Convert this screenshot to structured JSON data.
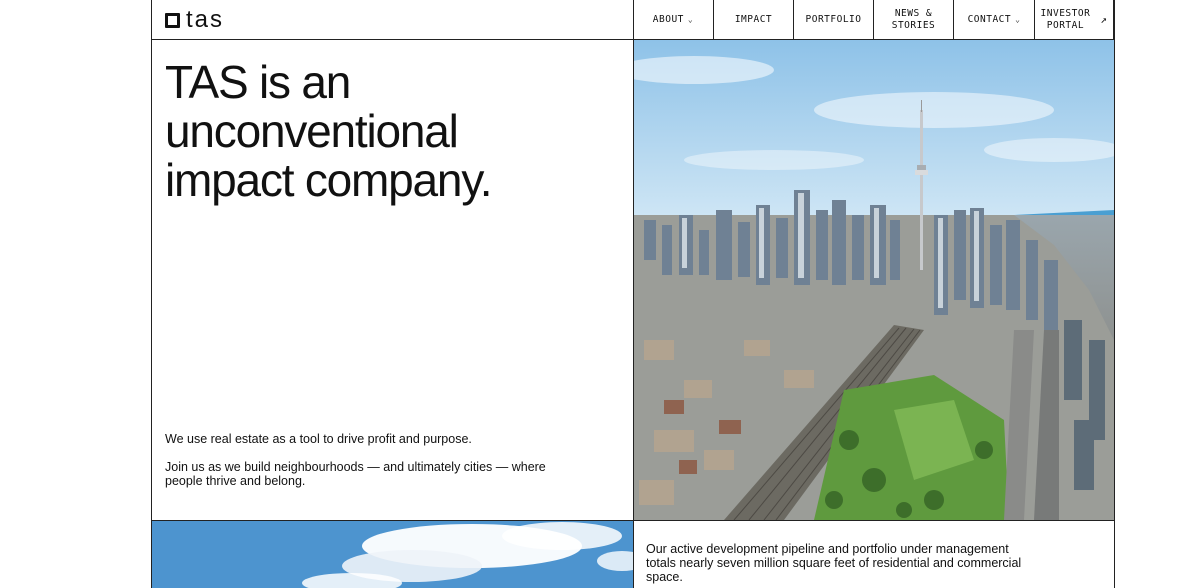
{
  "brand": {
    "logo_text": "tas"
  },
  "nav": {
    "items": [
      {
        "label": "ABOUT",
        "icon": "chevron-down-icon"
      },
      {
        "label": "IMPACT"
      },
      {
        "label": "PORTFOLIO"
      },
      {
        "label_line1": "NEWS &",
        "label_line2": "STORIES"
      },
      {
        "label": "CONTACT",
        "icon": "chevron-down-icon"
      },
      {
        "label_line1": "INVESTOR",
        "label_line2": "PORTAL",
        "icon": "external-arrow-icon"
      }
    ]
  },
  "hero": {
    "title_line1": "TAS is an",
    "title_line2": "unconventional",
    "title_line3": "impact company.",
    "paragraph1": "We use real estate as a tool to drive profit and purpose.",
    "paragraph2": "Join us as we build neighbourhoods — and ultimately cities — where people thrive and belong."
  },
  "stats": {
    "text": "Our active development pipeline and portfolio under management totals nearly seven million square feet of residential and commercial space."
  },
  "colors": {
    "border": "#222222",
    "sky": "#9cc9ea",
    "water": "#4aa0d4",
    "park": "#5f9a3e"
  }
}
